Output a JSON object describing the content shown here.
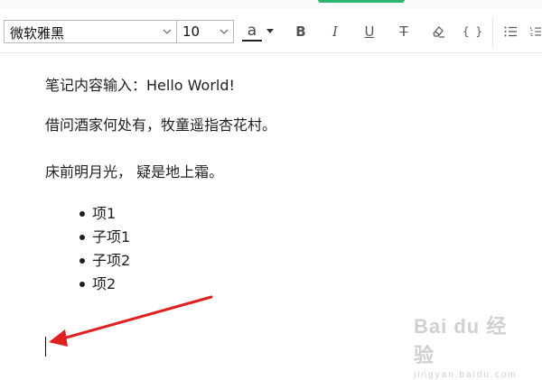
{
  "toolbar": {
    "font_family_value": "微软雅黑",
    "font_size_value": "10",
    "font_color_glyph": "a",
    "bold_glyph": "B",
    "italic_glyph": "I",
    "underline_glyph": "U",
    "strikethrough_glyph": "T",
    "code_glyph": "{ }"
  },
  "editor": {
    "paragraphs": [
      "笔记内容输入：Hello World!",
      "借问酒家何处有，牧童遥指杏花村。",
      "床前明月光，  疑是地上霜。"
    ],
    "list_items": [
      "项1",
      "子项1",
      "子项2",
      "项2"
    ]
  },
  "watermark": {
    "brand": "Bai du 经验",
    "sub": "jingyan.baidu.com"
  },
  "colors": {
    "accent_green": "#2bb673",
    "arrow_red": "#e02020"
  },
  "icons": [
    "chevron-down-icon",
    "font-color-icon",
    "bold-icon",
    "italic-icon",
    "underline-icon",
    "strikethrough-icon",
    "eraser-icon",
    "code-icon",
    "bulleted-list-icon",
    "numbered-list-icon",
    "arrow-annotation"
  ]
}
